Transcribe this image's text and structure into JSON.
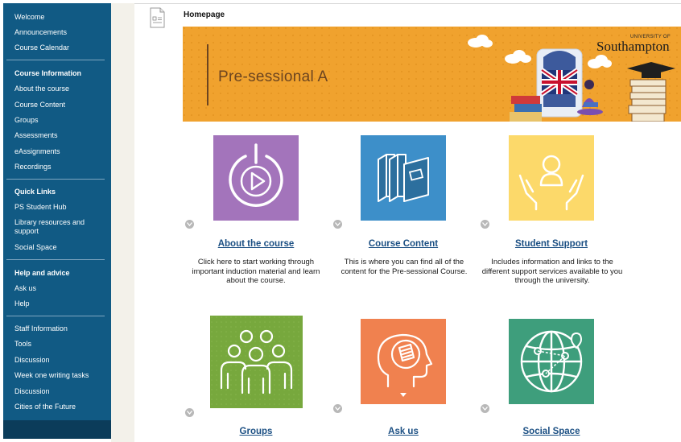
{
  "sidebar": {
    "items": [
      {
        "label": "Welcome"
      },
      {
        "label": "Announcements"
      },
      {
        "label": "Course Calendar"
      },
      {
        "label": "Course Information"
      },
      {
        "label": "About the course"
      },
      {
        "label": "Course Content"
      },
      {
        "label": "Groups"
      },
      {
        "label": "Assessments"
      },
      {
        "label": "eAssignments"
      },
      {
        "label": "Recordings"
      },
      {
        "label": "Quick Links"
      },
      {
        "label": "PS Student Hub"
      },
      {
        "label": "Library resources and support"
      },
      {
        "label": "Social Space"
      },
      {
        "label": "Help and advice"
      },
      {
        "label": "Ask us"
      },
      {
        "label": "Help"
      },
      {
        "label": "Staff Information"
      },
      {
        "label": "Tools"
      },
      {
        "label": "Discussion"
      },
      {
        "label": "Week one writing tasks"
      },
      {
        "label": "Discussion"
      },
      {
        "label": "Cities of the Future"
      }
    ]
  },
  "page": {
    "title": "Homepage",
    "banner": {
      "title": "Pre-sessional A",
      "university_small": "UNIVERSITY OF",
      "university_big": "Southampton"
    }
  },
  "cards": [
    {
      "title": "About the course",
      "description": "Click here to start working through important induction material and learn about the course.",
      "color": "#a374bb",
      "icon": "power-play-icon"
    },
    {
      "title": "Course Content",
      "description": "This is where you can find all of the content for the Pre-sessional Course.",
      "color": "#3d8fc9",
      "icon": "books-icon"
    },
    {
      "title": "Student Support",
      "description": "Includes information and links to the different support services available to you through the university.",
      "color": "#fcd96a",
      "icon": "hands-person-icon"
    },
    {
      "title": "Groups",
      "description": "",
      "color": "#77a83d",
      "icon": "people-group-icon"
    },
    {
      "title": "Ask us",
      "description": "",
      "color": "#f0814f",
      "icon": "head-question-icon"
    },
    {
      "title": "Social Space",
      "description": "",
      "color": "#3e9e7c",
      "icon": "globe-icon"
    }
  ],
  "colors": {
    "sidebar": "#115a84",
    "link": "#1b4f83",
    "banner": "#f0a22e"
  }
}
